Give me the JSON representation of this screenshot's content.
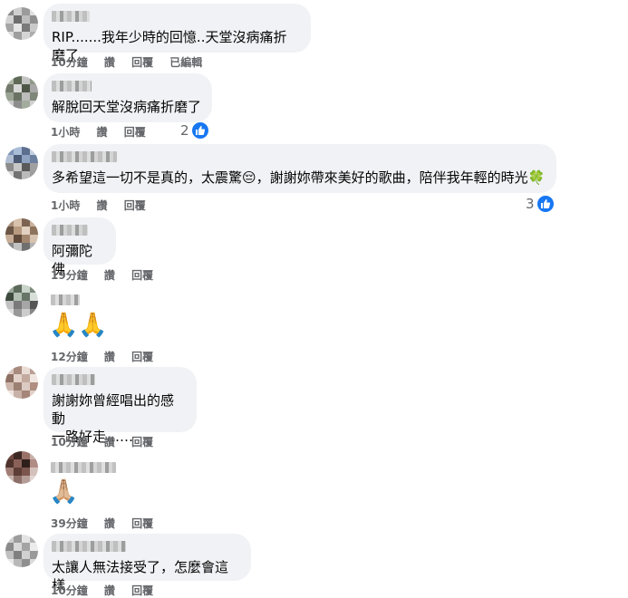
{
  "comments": [
    {
      "text": "RIP.......我年少時的回憶..天堂沒病痛折磨了",
      "time": "10分鐘",
      "like": "讚",
      "reply": "回覆",
      "edited": "已編輯"
    },
    {
      "text": "解脫回天堂沒病痛折磨了",
      "time": "1小時",
      "like": "讚",
      "reply": "回覆",
      "reactions": "2"
    },
    {
      "text_a": "多希望這一切不是真的，太震驚",
      "emoji_a": "😔",
      "text_b": "，謝謝妳帶來美好的歌曲，陪伴我年輕的時光",
      "emoji_b": "🍀",
      "time": "1小時",
      "like": "讚",
      "reply": "回覆",
      "reactions": "3"
    },
    {
      "text": "阿彌陀佛",
      "time": "19分鐘",
      "like": "讚",
      "reply": "回覆"
    },
    {
      "text": "🙏🙏",
      "time": "12分鐘",
      "like": "讚",
      "reply": "回覆"
    },
    {
      "text": "謝謝妳曾經唱出的感動\n一路好走……",
      "time": "10分鐘",
      "like": "讚",
      "reply": "回覆"
    },
    {
      "text": "🙏🏼",
      "time": "39分鐘",
      "like": "讚",
      "reply": "回覆"
    },
    {
      "text": "太讓人無法接受了，怎麼會這樣",
      "time": "10分鐘",
      "like": "讚",
      "reply": "回覆"
    }
  ],
  "colors": {
    "bubble": "#f0f2f5",
    "meta": "#65676b",
    "like_badge": "#1877f2"
  },
  "icons": {
    "like": "thumbs-up-icon",
    "avatar": "blurred-avatar"
  }
}
